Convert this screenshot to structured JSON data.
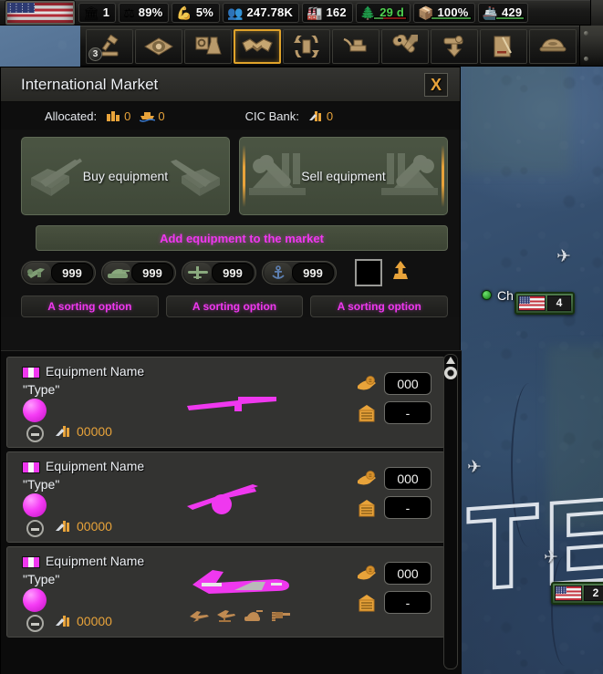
{
  "topbar": {
    "flag_icon": "us-flag",
    "resources": [
      {
        "icon": "political-power-icon",
        "glyph": "🏛",
        "value": "1",
        "bar": null
      },
      {
        "icon": "stability-icon",
        "glyph": "⚖",
        "value": "89%",
        "bar": null
      },
      {
        "icon": "war-support-icon",
        "glyph": "💪",
        "value": "5%",
        "bar": null
      },
      {
        "icon": "manpower-icon",
        "glyph": "👥",
        "value": "247.78K",
        "bar": null
      },
      {
        "icon": "factory-icon",
        "glyph": "🏭",
        "value": "162",
        "bar": null
      },
      {
        "icon": "construction-icon",
        "glyph": "🌲",
        "value": "29 d",
        "value_color": "#4fd14f",
        "bar": 30
      },
      {
        "icon": "convoy-icon",
        "glyph": "📦",
        "value": "100%",
        "bar": 100
      },
      {
        "icon": "naval-icon",
        "glyph": "🚢",
        "value": "429",
        "bar": 100
      }
    ]
  },
  "toolbar": {
    "items": [
      {
        "name": "politics-icon",
        "label": "Politics",
        "badge": "3",
        "selected": false
      },
      {
        "name": "intelligence-eye-icon",
        "label": "Intelligence",
        "badge": null,
        "selected": false
      },
      {
        "name": "research-icon",
        "label": "Research",
        "badge": null,
        "selected": false
      },
      {
        "name": "diplomacy-handshake-icon",
        "label": "Diplomacy",
        "badge": null,
        "selected": true
      },
      {
        "name": "trade-icon",
        "label": "Trade",
        "badge": null,
        "selected": false
      },
      {
        "name": "production-icon",
        "label": "Production",
        "badge": null,
        "selected": false
      },
      {
        "name": "logistics-wrench-icon",
        "label": "Logistics",
        "badge": null,
        "selected": false
      },
      {
        "name": "army-deployment-icon",
        "label": "Deployment",
        "badge": null,
        "selected": false
      },
      {
        "name": "decisions-icon",
        "label": "Decisions",
        "badge": null,
        "selected": false
      },
      {
        "name": "officer-cap-icon",
        "label": "High Command",
        "badge": null,
        "selected": false
      }
    ]
  },
  "window": {
    "title": "International Market",
    "close_label": "X",
    "allocated": {
      "label": "Allocated:",
      "factory_icon": "factory-icon",
      "factory_value": "0",
      "convoy_icon": "convoy-ship-icon",
      "convoy_value": "0"
    },
    "cic_bank": {
      "label": "CIC Bank:",
      "icon": "cic-factory-icon",
      "value": "0"
    },
    "modes": [
      {
        "name": "buy-equipment-button",
        "label": "Buy equipment",
        "selected": false
      },
      {
        "name": "sell-equipment-button",
        "label": "Sell equipment",
        "selected": true
      }
    ],
    "add_button": {
      "label": "Add equipment to the market"
    },
    "stock_filters": [
      {
        "icon": "infantry-equipment-icon",
        "value": "999"
      },
      {
        "icon": "armor-equipment-icon",
        "value": "999"
      },
      {
        "icon": "air-equipment-icon",
        "value": "999"
      },
      {
        "icon": "naval-equipment-icon",
        "value": "999"
      }
    ],
    "color_swatch": "#000000",
    "sort_direction_icon": "sort-ascending-arrow-icon",
    "sort_options": [
      {
        "label": "A sorting option"
      },
      {
        "label": "A sorting option"
      },
      {
        "label": "A sorting option"
      }
    ],
    "list": [
      {
        "flag_icon": "placeholder-flag-icon",
        "name": "Equipment Name",
        "type": "\"Type\"",
        "orb_icon": "placeholder-orb-icon",
        "remove_icon": "minus-circle-icon",
        "cost_icon": "cic-factory-icon",
        "cost": "00000",
        "art_icon": "rifle-silhouette-icon",
        "sub_icons": [],
        "price_icon": "hand-with-coin-icon",
        "price": "000",
        "stock_icon": "warehouse-icon",
        "stock": "-"
      },
      {
        "flag_icon": "placeholder-flag-icon",
        "name": "Equipment Name",
        "type": "\"Type\"",
        "orb_icon": "placeholder-orb-icon",
        "remove_icon": "minus-circle-icon",
        "cost_icon": "cic-factory-icon",
        "cost": "00000",
        "art_icon": "artillery-silhouette-icon",
        "sub_icons": [],
        "price_icon": "hand-with-coin-icon",
        "price": "000",
        "stock_icon": "warehouse-icon",
        "stock": "-"
      },
      {
        "flag_icon": "placeholder-flag-icon",
        "name": "Equipment Name",
        "type": "\"Type\"",
        "orb_icon": "placeholder-orb-icon",
        "remove_icon": "minus-circle-icon",
        "cost_icon": "cic-factory-icon",
        "cost": "00000",
        "art_icon": "aircraft-silhouette-icon",
        "sub_icons": [
          "aircraft-small-icon",
          "aircraft-stand-small-icon",
          "tank-small-icon",
          "support-small-icon"
        ],
        "price_icon": "hand-with-coin-icon",
        "price": "000",
        "stock_icon": "warehouse-icon",
        "stock": "-"
      }
    ],
    "scrollbar": {
      "up_icon": "scroll-up-triangle-icon",
      "thumb_icon": "scroll-thumb-icon"
    }
  },
  "map": {
    "big_label": "TES",
    "city": {
      "dot_icon": "city-dot-icon",
      "name": "Ch"
    },
    "counters": [
      {
        "flag_icon": "us-flag-icon",
        "value": "4"
      },
      {
        "flag_icon": "us-flag-icon",
        "value": "2"
      }
    ],
    "plane_markers": [
      "plane-marker-icon",
      "plane-marker-icon",
      "plane-marker-icon"
    ]
  }
}
